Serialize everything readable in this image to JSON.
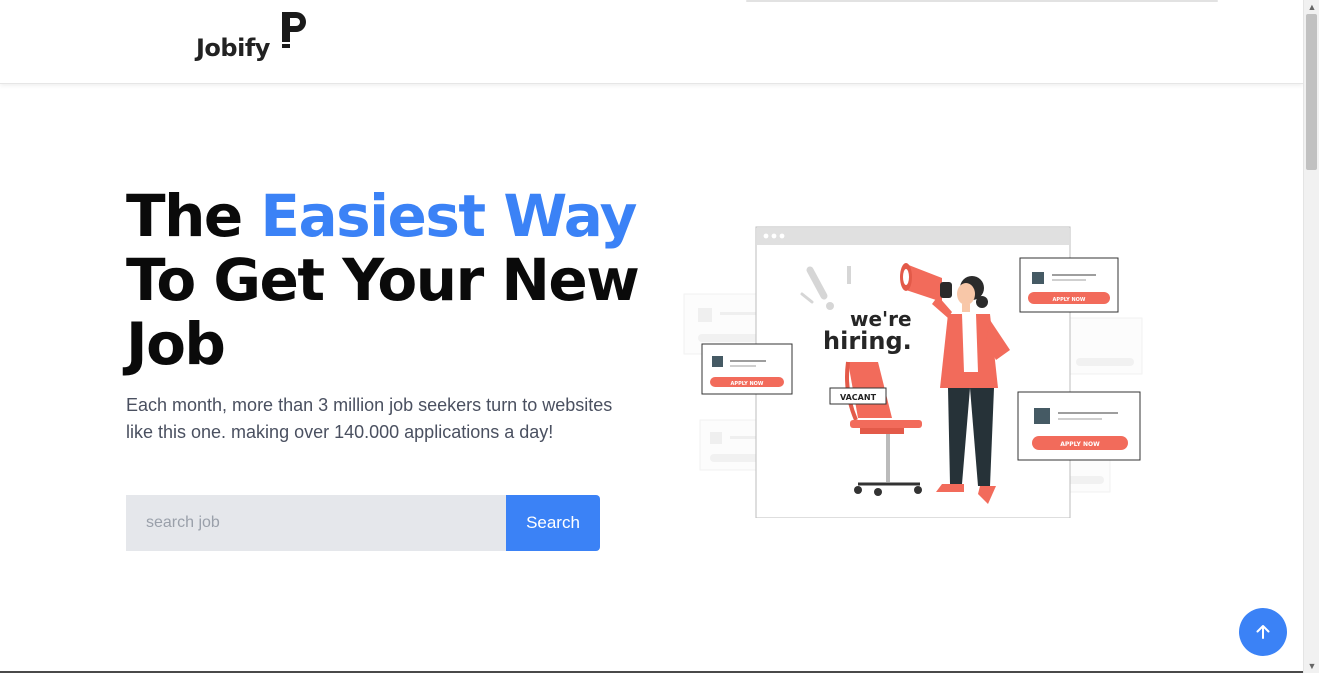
{
  "brand": {
    "name": "Jobify"
  },
  "hero": {
    "title_part1": "The ",
    "title_accent": "Easiest Way",
    "title_part2": "To Get Your New Job",
    "description": "Each month, more than 3 million job seekers turn to websites like this one. making over 140.000 applications a day!"
  },
  "search": {
    "placeholder": "search job",
    "value": "",
    "button_label": "Search"
  },
  "illustration": {
    "headline_line1": "we're",
    "headline_line2": "hiring.",
    "sign": "VACANT",
    "apply_label": "APPLY NOW"
  },
  "icons": {
    "logo_mark": "p-logo-mark",
    "back_to_top": "arrow-up-icon",
    "scroll_up": "scroll-up-arrow",
    "scroll_down": "scroll-down-arrow"
  },
  "colors": {
    "accent": "#3b82f6",
    "illustration_red": "#f26b5b",
    "input_bg": "#e5e7eb",
    "text_dark": "#0a0a0a",
    "text_muted": "#4a5060"
  }
}
